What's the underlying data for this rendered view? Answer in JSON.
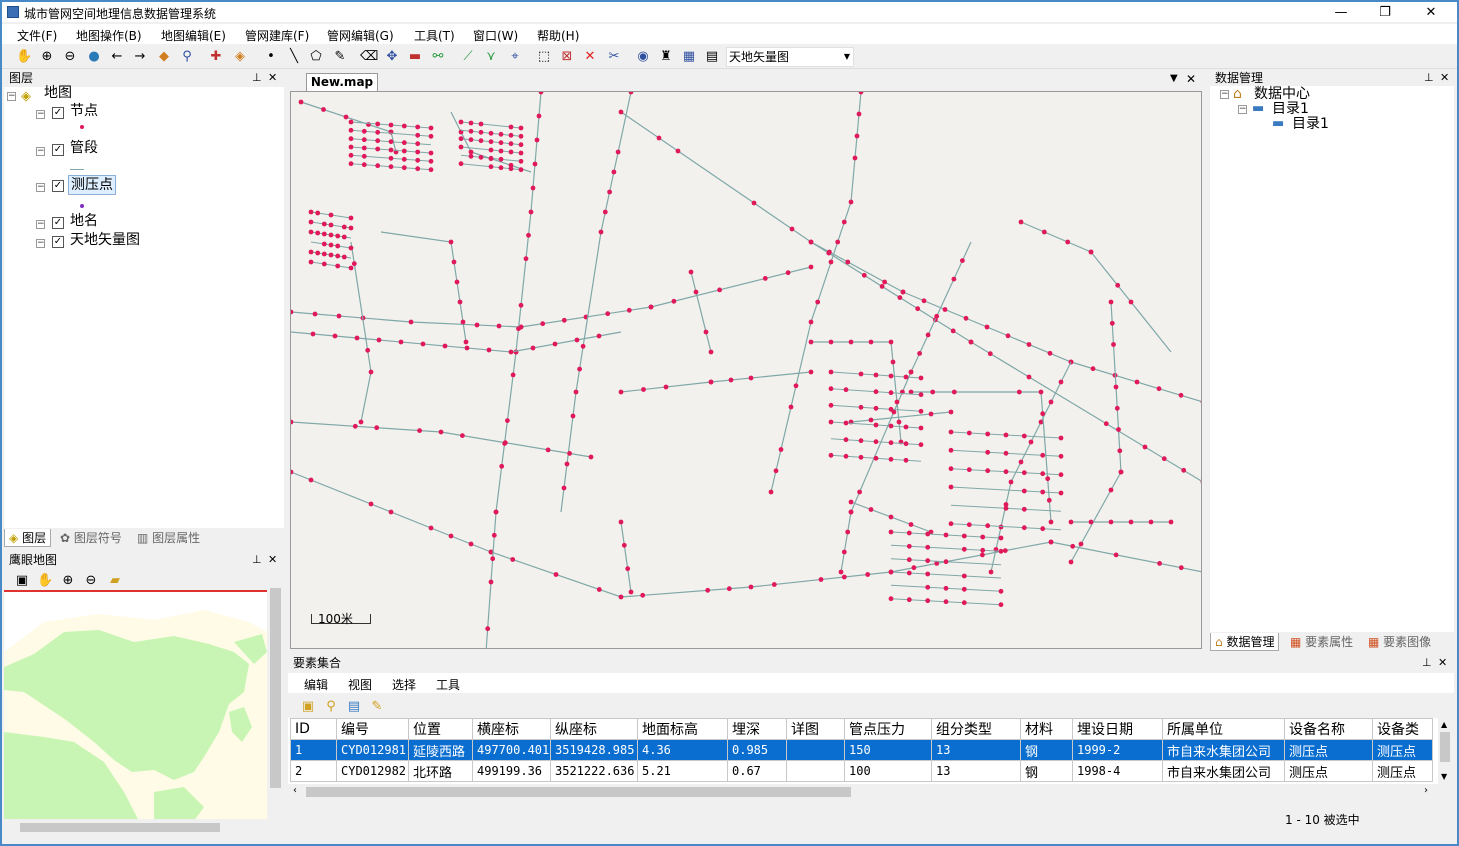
{
  "app": {
    "title": "城市管网空间地理信息数据管理系统"
  },
  "window_controls": {
    "minimize": "—",
    "maximize": "❐",
    "close": "✕"
  },
  "menu": [
    "文件(F)",
    "地图操作(B)",
    "地图编辑(E)",
    "管网建库(F)",
    "管网编辑(G)",
    "工具(T)",
    "窗口(W)",
    "帮助(H)"
  ],
  "toolbar": {
    "basemap_select": "天地矢量图"
  },
  "layers_panel": {
    "title": "图层",
    "root": "地图",
    "items": [
      "节点",
      "管段",
      "测压点",
      "地名",
      "天地矢量图"
    ],
    "tabs": [
      "图层",
      "图层符号",
      "图层属性"
    ]
  },
  "eagle_panel": {
    "title": "鹰眼地图"
  },
  "map_doc": {
    "tab": "New.map",
    "scale_label": "100米"
  },
  "data_panel": {
    "title": "数据管理",
    "root": "数据中心",
    "dir1": "目录1",
    "dir2": "目录1",
    "tabs": [
      "数据管理",
      "要素属性",
      "要素图像"
    ]
  },
  "features_panel": {
    "title": "要素集合",
    "menu": [
      "编辑",
      "视图",
      "选择",
      "工具"
    ],
    "columns": [
      "ID",
      "编号",
      "位置",
      "横座标",
      "纵座标",
      "地面标高",
      "埋深",
      "详图",
      "管点压力",
      "组分类型",
      "材料",
      "埋设日期",
      "所属单位",
      "设备名称",
      "设备类"
    ],
    "rows": [
      [
        "1",
        "CYD012981",
        "延陵西路",
        "497700.401",
        "3519428.985",
        "4.36",
        "0.985",
        "",
        "150",
        "13",
        "钢",
        "1999-2",
        "市自来水集团公司",
        "测压点",
        "测压点"
      ],
      [
        "2",
        "CYD012982",
        "北环路",
        "499199.36",
        "3521222.636",
        "5.21",
        "0.67",
        "",
        "100",
        "13",
        "钢",
        "1998-4",
        "市自来水集团公司",
        "测压点",
        "测压点"
      ]
    ],
    "status": "1 - 10 被选中"
  },
  "colors": {
    "accent_select": "#0a6ed1",
    "pipe": "#7fa8a8",
    "node": "#e0195a",
    "land": "#c8f5b4"
  }
}
